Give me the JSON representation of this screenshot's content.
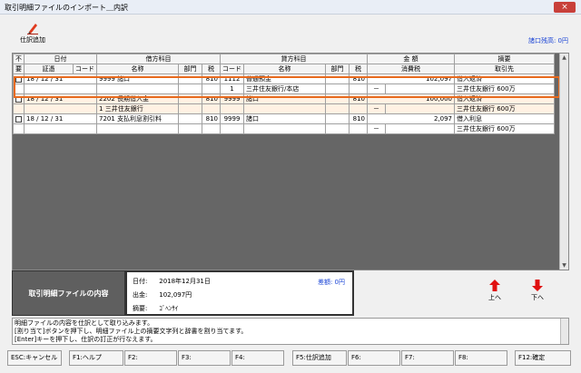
{
  "window": {
    "title": "取引明細ファイルのインポート＿内訳",
    "close_glyph": "×"
  },
  "toolbar": {
    "add_entry_label": "仕訳追加",
    "add_entry_icon": "pencil-icon"
  },
  "balance_text": "諸口残高: 0円",
  "headers": {
    "row1": {
      "unneeded": "不",
      "date": "日付",
      "debit": "借方科目",
      "credit": "貸方科目",
      "amount": "金 額",
      "summary": "摘要"
    },
    "row2": {
      "unneeded": "要",
      "voucher": "証憑",
      "code": "コード",
      "name": "名称",
      "dept": "部門",
      "tax": "税",
      "code2": "コード",
      "name2": "名称",
      "dept2": "部門",
      "tax2": "税",
      "consumption_tax": "消費税",
      "partner": "取引先"
    }
  },
  "entries": [
    {
      "date": "18 / 12 / 31",
      "debit_code": "9999",
      "debit_name": "諸口",
      "debit_tax": "810",
      "credit_code": "1112",
      "credit_name": "普通預金",
      "credit_tax": "810",
      "amount": "102,097",
      "summary": "借入返済",
      "sub": {
        "debit_code": "",
        "debit_name": "",
        "credit_code": "1",
        "credit_name": "三井住友銀行/本店",
        "tax_mark": "－",
        "partner": "三井住友銀行 600万"
      }
    },
    {
      "date": "18 / 12 / 31",
      "debit_code": "2202",
      "debit_name": "長期借入金",
      "debit_tax": "810",
      "credit_code": "9999",
      "credit_name": "諸口",
      "credit_tax": "810",
      "amount": "100,000",
      "summary": "借入返済",
      "sub": {
        "debit_code": "1",
        "debit_name": "三井住友銀行",
        "credit_code": "",
        "credit_name": "",
        "tax_mark": "－",
        "partner": "三井住友銀行 600万"
      }
    },
    {
      "date": "18 / 12 / 31",
      "debit_code": "7201",
      "debit_name": "支払利息割引料",
      "debit_tax": "810",
      "credit_code": "9999",
      "credit_name": "諸口",
      "credit_tax": "810",
      "amount": "2,097",
      "summary": "借入利息",
      "sub": {
        "debit_code": "",
        "debit_name": "",
        "credit_code": "",
        "credit_name": "",
        "tax_mark": "－",
        "partner": "三井住友銀行 600万"
      }
    }
  ],
  "detail": {
    "label": "取引明細ファイルの内容",
    "date_key": "日付:",
    "date_value": "2018年12月31日",
    "withdraw_key": "出金:",
    "withdraw_value": "102,097円",
    "summary_key": "摘要:",
    "summary_value": "ｺﾞﾍﾝｻｲ",
    "diff": "差額: 0円"
  },
  "nav": {
    "up_label": "上へ",
    "down_label": "下へ",
    "accent": "#e01010"
  },
  "message": {
    "line1": "明細ファイルの内容を仕訳として取り込みます。",
    "line2": "[割り当て]ボタンを押下し、明細ファイル上の摘要文字列と辞書を割り当てます。",
    "line3": "[Enter]キーを押下し、仕訳の訂正が行なえます。"
  },
  "fkeys": [
    "ESC:キャンセル",
    "F1:ヘルプ",
    "F2:",
    "F3:",
    "F4:",
    "F5:仕訳追加",
    "F6:",
    "F7:",
    "F8:",
    "F12:確定"
  ]
}
